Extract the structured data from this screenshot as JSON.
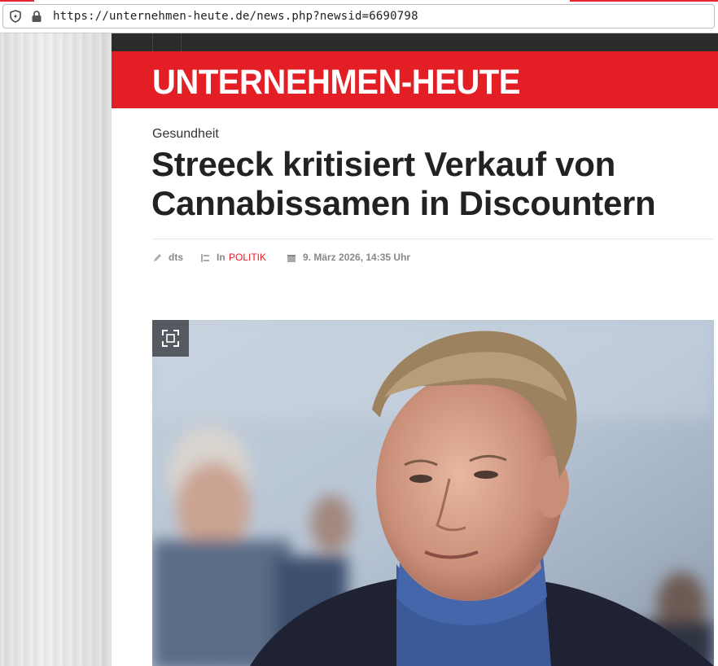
{
  "browser": {
    "url": "https://unternehmen-heute.de/news.php?newsid=6690798",
    "icons": {
      "shield": "shield-bolt-icon",
      "lock": "lock-icon"
    }
  },
  "site": {
    "logo": "UNTERNEHMEN-HEUTE",
    "accent": "#e31e24"
  },
  "article": {
    "category": "Gesundheit",
    "headline": "Streeck kritisiert Verkauf von Cannabissamen in Discountern",
    "meta": {
      "author": "dts",
      "in_label": "In",
      "section": "POLITIK",
      "date": "9. März 2026, 14:35 Uhr"
    },
    "image": {
      "expand_icon": "expand-icon"
    }
  }
}
